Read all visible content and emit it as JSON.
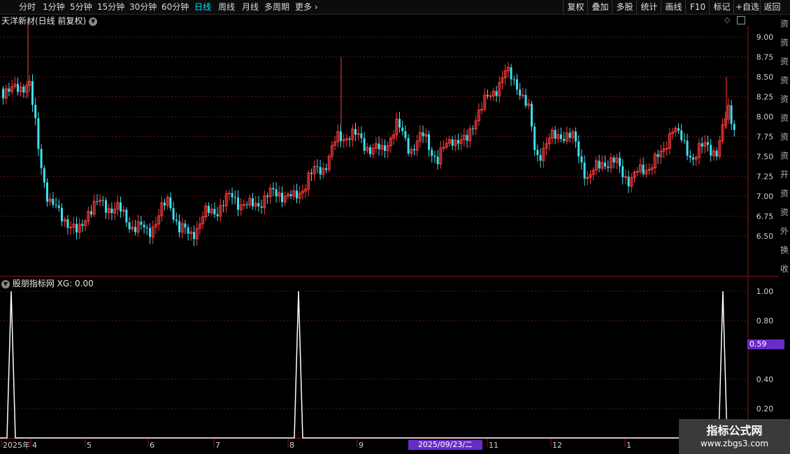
{
  "toolbar": {
    "periods": [
      "分时",
      "1分钟",
      "5分钟",
      "15分钟",
      "30分钟",
      "60分钟",
      "日线",
      "周线",
      "月线",
      "多周期",
      "更多"
    ],
    "active_period": "日线",
    "right_buttons": [
      "复权",
      "叠加",
      "多股",
      "统计",
      "画线",
      "F10",
      "标记",
      "+自选",
      "返回"
    ]
  },
  "main_chart": {
    "title": "天洋新材(日线 前复权)",
    "price_ticks": [
      "9.00",
      "8.75",
      "8.50",
      "8.25",
      "8.00",
      "7.75",
      "7.50",
      "7.25",
      "7.00",
      "6.75",
      "6.50"
    ],
    "colors": {
      "up": "#ff3c3c",
      "down": "#3ce0f0",
      "grid": "#5a1a1a"
    }
  },
  "indicator": {
    "title": "股朋指标网",
    "xg_label": "XG: 0.00",
    "ticks": [
      "1.00",
      "0.80",
      "0.40",
      "0.20"
    ],
    "current_value": "0.59",
    "line_color": "#ffffff"
  },
  "x_axis": {
    "labels": [
      "2025年",
      "4",
      "5",
      "6",
      "7",
      "8",
      "9",
      "11",
      "12",
      "1"
    ],
    "cursor_date": "2025/09/23/二"
  },
  "right_strip": {
    "chars": [
      "资",
      "资",
      "资",
      "资",
      "资",
      "资",
      "资",
      "资",
      "开",
      "资",
      "资",
      "外",
      "换",
      "收"
    ]
  },
  "watermark": {
    "line1": "指标公式网",
    "line2": "www.zbgs3.com"
  }
}
